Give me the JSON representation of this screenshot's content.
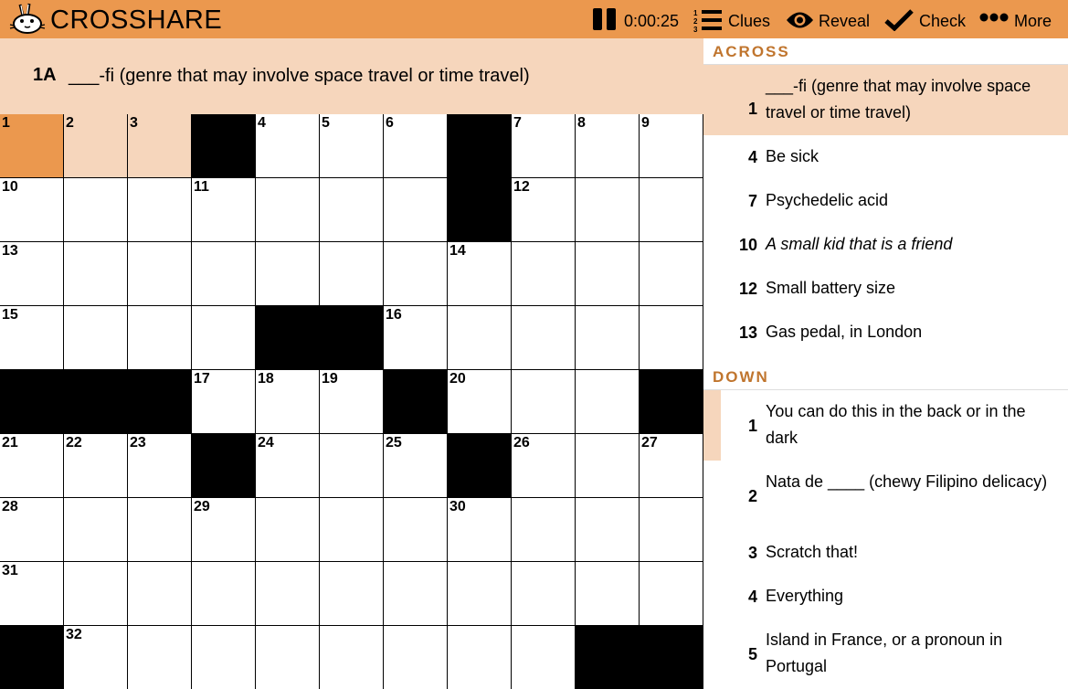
{
  "app": {
    "brand": "CROSSHARE"
  },
  "toolbar": {
    "timer": "0:00:25",
    "clues_label": "Clues",
    "reveal_label": "Reveal",
    "check_label": "Check",
    "more_label": "More"
  },
  "current_clue": {
    "number": "1A",
    "text": "___-fi (genre that may involve space travel or time travel)"
  },
  "colors": {
    "accent": "#eb984e",
    "highlight": "#f6d6bc",
    "section_title": "#c0752e"
  },
  "grid": {
    "numbers": [
      [
        "1",
        "2",
        "3",
        "",
        "4",
        "5",
        "6",
        "",
        "7",
        "8",
        "9"
      ],
      [
        "10",
        "",
        "",
        "11",
        "",
        "",
        "",
        "",
        "12",
        "",
        ""
      ],
      [
        "13",
        "",
        "",
        "",
        "",
        "",
        "",
        "14",
        "",
        "",
        ""
      ],
      [
        "15",
        "",
        "",
        "",
        "",
        "",
        "16",
        "",
        "",
        "",
        ""
      ],
      [
        "",
        "",
        "",
        "17",
        "18",
        "19",
        "",
        "20",
        "",
        "",
        ""
      ],
      [
        "21",
        "22",
        "23",
        "",
        "24",
        "",
        "25",
        "",
        "26",
        "",
        "27"
      ],
      [
        "28",
        "",
        "",
        "29",
        "",
        "",
        "",
        "30",
        "",
        "",
        ""
      ],
      [
        "31",
        "",
        "",
        "",
        "",
        "",
        "",
        "",
        "",
        "",
        ""
      ],
      [
        "",
        "32",
        "",
        "",
        "",
        "",
        "",
        "",
        "",
        "",
        ""
      ]
    ]
  },
  "across": {
    "title": "ACROSS",
    "clues": [
      {
        "number": "1",
        "text": "___-fi (genre that may involve space travel or time travel)"
      },
      {
        "number": "4",
        "text": "Be sick"
      },
      {
        "number": "7",
        "text": "Psychedelic acid"
      },
      {
        "number": "10",
        "text": "A small kid that is a friend"
      },
      {
        "number": "12",
        "text": "Small battery size"
      },
      {
        "number": "13",
        "text": "Gas pedal, in London"
      }
    ]
  },
  "down": {
    "title": "DOWN",
    "clues": [
      {
        "number": "1",
        "text": "You can do this in the back or in the dark"
      },
      {
        "number": "2",
        "text": "Nata de ____ (chewy Filipino delicacy)"
      },
      {
        "number": "3",
        "text": "Scratch that!"
      },
      {
        "number": "4",
        "text": "Everything"
      },
      {
        "number": "5",
        "text": "Island in France, or a pronoun in Portugal"
      }
    ]
  }
}
